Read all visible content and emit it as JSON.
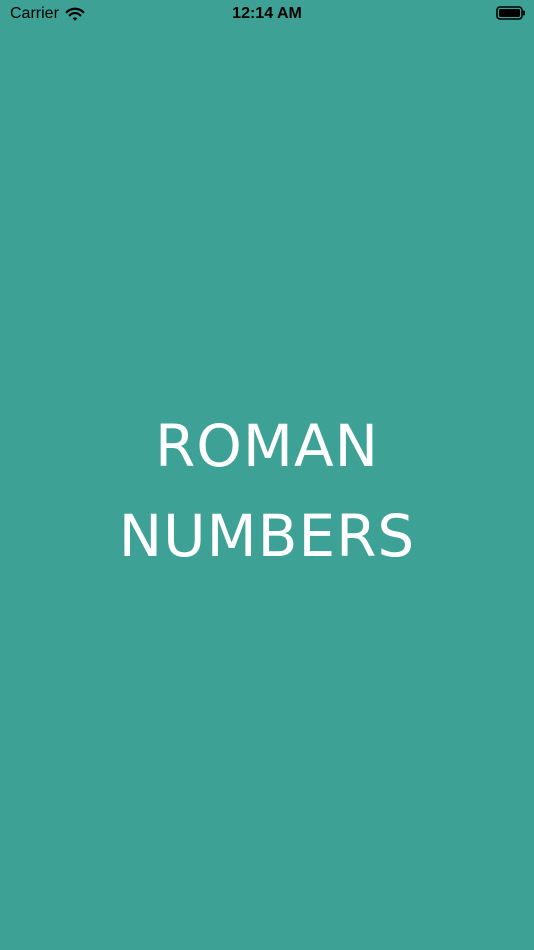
{
  "status_bar": {
    "carrier": "Carrier",
    "time": "12:14 AM"
  },
  "splash": {
    "title_line_1": "ROMAN",
    "title_line_2": "NUMBERS"
  },
  "colors": {
    "background": "#3da295",
    "text": "#ffffff"
  }
}
